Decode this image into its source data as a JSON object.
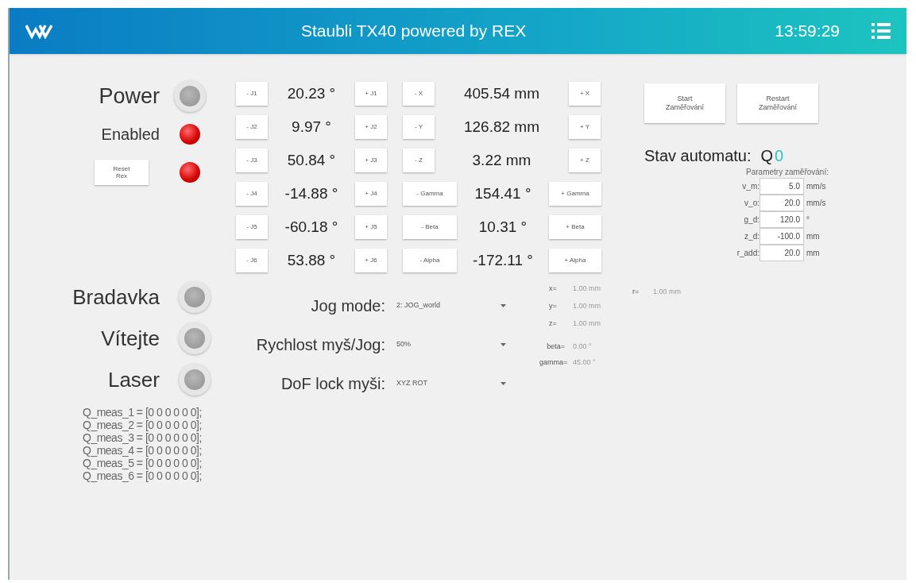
{
  "header": {
    "title": "Staubli TX40 powered by REX",
    "time": "13:59:29"
  },
  "status_lamps": [
    {
      "label": "Power",
      "on": false,
      "kind": "label"
    },
    {
      "label": "Enabled",
      "on": true,
      "kind": "label"
    },
    {
      "label": "Reset\nRex",
      "on": true,
      "kind": "button"
    }
  ],
  "jog_rows": [
    {
      "minus": "- J1",
      "value": "20.23 °",
      "plus": "+ J1",
      "cart_minus": "- X",
      "cart_value": "405.54 mm",
      "cart_plus": "+ X"
    },
    {
      "minus": "- J2",
      "value": "9.97 °",
      "plus": "+ J2",
      "cart_minus": "- Y",
      "cart_value": "126.82 mm",
      "cart_plus": "+ Y"
    },
    {
      "minus": "- J3",
      "value": "50.84 °",
      "plus": "+ J3",
      "cart_minus": "- Z",
      "cart_value": "3.22 mm",
      "cart_plus": "+ Z"
    },
    {
      "minus": "- J4",
      "value": "-14.88 °",
      "plus": "+ J4",
      "cart_minus": "- Gamma",
      "cart_value": "154.41 °",
      "cart_plus": "+ Gamma"
    },
    {
      "minus": "- J5",
      "value": "-60.18 °",
      "plus": "+ J5",
      "cart_minus": "- Beta",
      "cart_value": "10.31 °",
      "cart_plus": "+ Beta"
    },
    {
      "minus": "- J6",
      "value": "53.88 °",
      "plus": "+ J6",
      "cart_minus": "- Alpha",
      "cart_value": "-172.11 °",
      "cart_plus": "+ Alpha"
    }
  ],
  "aiming_buttons": [
    "Start\nZaměřování",
    "Restart\nZaměřování"
  ],
  "automat_state": {
    "label": "Stav automatu:",
    "prefix": "Q",
    "value": "0"
  },
  "aiming_params": {
    "title": "Parametry zaměřování:",
    "fields": [
      {
        "label": "v_m:",
        "value": "5.0",
        "unit": "mm/s"
      },
      {
        "label": "v_o:",
        "value": "20.0",
        "unit": "mm/s"
      },
      {
        "label": "g_d:",
        "value": "120.0",
        "unit": "°"
      },
      {
        "label": "z_d:",
        "value": "-100.0",
        "unit": "mm"
      },
      {
        "label": "r_add:",
        "value": "20.0",
        "unit": "mm"
      }
    ]
  },
  "lamps": [
    {
      "label": "Bradavka",
      "on": false
    },
    {
      "label": "Vítejte",
      "on": false
    },
    {
      "label": "Laser",
      "on": false
    }
  ],
  "dropdowns": [
    {
      "label": "Jog mode:",
      "value": "2: JOG_world"
    },
    {
      "label": "Rychlost myš/Jog:",
      "value": "50%"
    },
    {
      "label": "DoF lock myši:",
      "value": "XYZ ROT"
    }
  ],
  "readouts": [
    {
      "label": "x=",
      "value": "1.00 mm"
    },
    {
      "label": "y=",
      "value": "1.00 mm"
    },
    {
      "label": "z=",
      "value": "1.00 mm"
    }
  ],
  "angle_readouts": [
    {
      "label": "beta=",
      "value": "0.00 °"
    },
    {
      "label": "gamma=",
      "value": "45.00 °"
    }
  ],
  "r_readout": {
    "label": "r=",
    "value": "1.00 mm"
  },
  "q_meas": [
    "Q_meas_1 = [0 0 0 0 0 0];",
    "Q_meas_2 = [0 0 0 0 0 0];",
    "Q_meas_3 = [0 0 0 0 0 0];",
    "Q_meas_4 = [0 0 0 0 0 0];",
    "Q_meas_5 = [0 0 0 0 0 0];",
    "Q_meas_6 = [0 0 0 0 0 0];"
  ]
}
